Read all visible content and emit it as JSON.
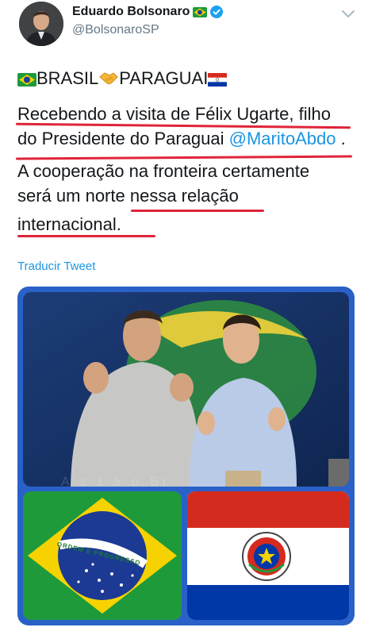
{
  "header": {
    "display_name": "Eduardo Bolsonaro",
    "handle": "@BolsonaroSP",
    "icons": [
      "avatar",
      "brazil-flag-icon",
      "verified-badge-icon",
      "chevron-down-icon"
    ]
  },
  "tweet": {
    "heading_left": "BRASIL",
    "heading_right": "PARAGUAI",
    "line1": "Recebendo a visita de Félix Ugarte, filho",
    "line2_prefix": "do Presidente do Paraguai ",
    "line2_mention": "@MaritoAbdo",
    "line2_suffix": " .",
    "line3": "A cooperação na fronteira certamente",
    "line4_prefix": "será um norte ",
    "line4_underlined": "nessa relação",
    "line5": "internacional.",
    "underline_color": "#e0243a",
    "mention_color": "#1b95e0"
  },
  "translate_link": "Traducir Tweet",
  "media": {
    "frame_color": "#2a61c8",
    "wall_text": "A s    t  á  o Br",
    "brazil_flag_banner": "ORDEM E PROGRESSO",
    "icons": [
      "photo",
      "brazil-flag-image",
      "paraguay-flag-image",
      "paraguay-seal-icon"
    ]
  }
}
